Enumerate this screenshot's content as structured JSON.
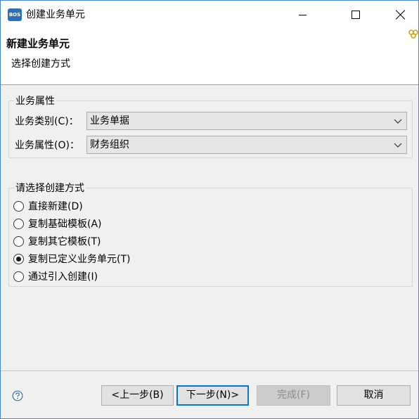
{
  "window": {
    "title": "创建业务单元",
    "icon_text": "BOS"
  },
  "header": {
    "title": "新建业务单元",
    "subtitle": "选择创建方式"
  },
  "properties_group": {
    "legend": "业务属性",
    "category_label": "业务类别(C)：",
    "category_value": "业务单据",
    "attribute_label": "业务属性(O)：",
    "attribute_value": "财务组织"
  },
  "method_group": {
    "legend": "请选择创建方式",
    "options": [
      {
        "label": "直接新建(D)",
        "checked": false
      },
      {
        "label": "复制基础模板(A)",
        "checked": false
      },
      {
        "label": "复制其它模板(T)",
        "checked": false
      },
      {
        "label": "复制已定义业务单元(T)",
        "checked": true
      },
      {
        "label": "通过引入创建(I)",
        "checked": false
      }
    ]
  },
  "footer": {
    "back_label": "<上一步(B)",
    "next_label": "下一步(N)>",
    "finish_label": "完成(F)",
    "cancel_label": "取消"
  },
  "colors": {
    "accent": "#0078d7",
    "window_border": "#4a86c8",
    "app_icon": "#2f6fb5",
    "header_icon": "#d4a017"
  }
}
